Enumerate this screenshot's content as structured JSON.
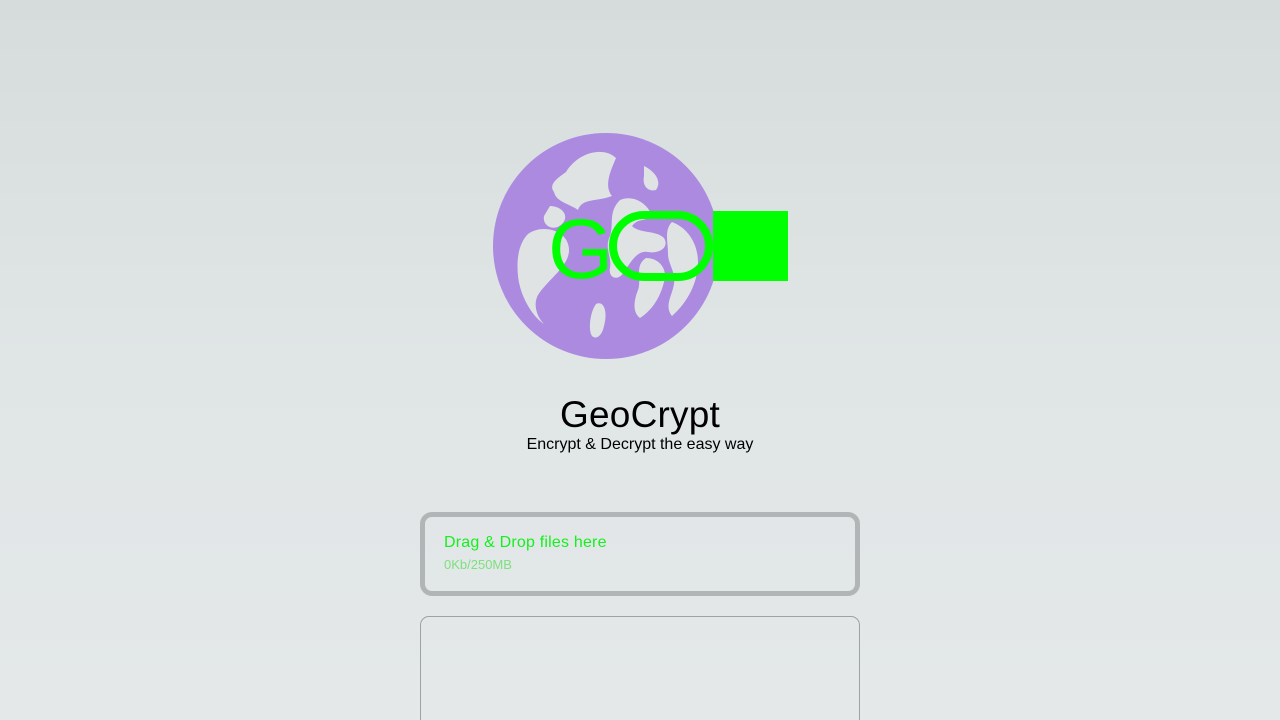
{
  "app": {
    "title": "GeoCrypt",
    "tagline": "Encrypt & Decrypt the easy way"
  },
  "logo": {
    "globe_icon": "globe-icon",
    "globe_color": "#ab8ae0",
    "badge_color": "#00ff00"
  },
  "dropzone": {
    "label": "Drag & Drop files here",
    "size_text": "0Kb/250MB",
    "label_color": "#14f01e"
  },
  "file_list": {
    "items": []
  }
}
